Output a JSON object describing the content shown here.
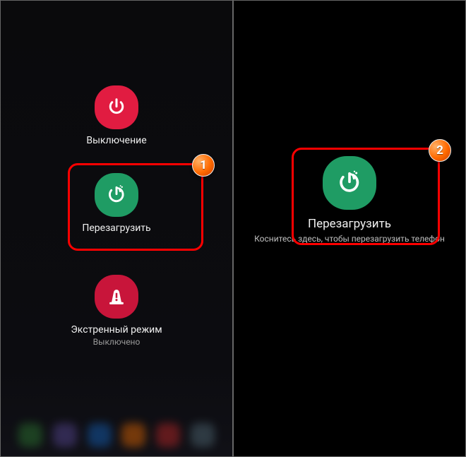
{
  "left": {
    "shutdown": {
      "label": "Выключение"
    },
    "restart": {
      "label": "Перезагрузить"
    },
    "emergency": {
      "label": "Экстренный режим",
      "sublabel": "Выключено"
    }
  },
  "right": {
    "restart": {
      "label": "Перезагрузить"
    },
    "hint": "Коснитесь здесь, чтобы перезагрузить телефон"
  },
  "annotations": {
    "badge1": "1",
    "badge2": "2"
  },
  "colors": {
    "red": "#e11c41",
    "green": "#1f9c64",
    "crimson": "#c8153a",
    "highlight": "#ff0000",
    "badge": "#ff6a00"
  }
}
